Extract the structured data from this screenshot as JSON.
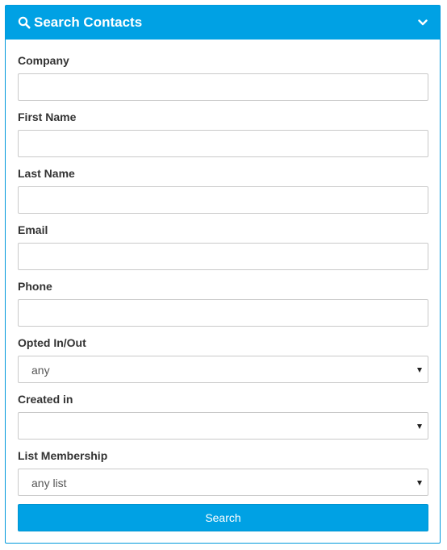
{
  "panel": {
    "title": "Search Contacts"
  },
  "fields": {
    "company": {
      "label": "Company",
      "value": ""
    },
    "first_name": {
      "label": "First Name",
      "value": ""
    },
    "last_name": {
      "label": "Last Name",
      "value": ""
    },
    "email": {
      "label": "Email",
      "value": ""
    },
    "phone": {
      "label": "Phone",
      "value": ""
    },
    "opted": {
      "label": "Opted In/Out",
      "selected": "any"
    },
    "created_in": {
      "label": "Created in",
      "selected": ""
    },
    "list_membership": {
      "label": "List Membership",
      "selected": "any list"
    }
  },
  "actions": {
    "search_label": "Search"
  },
  "colors": {
    "accent": "#00a1e4",
    "border": "#c9c9c9"
  }
}
